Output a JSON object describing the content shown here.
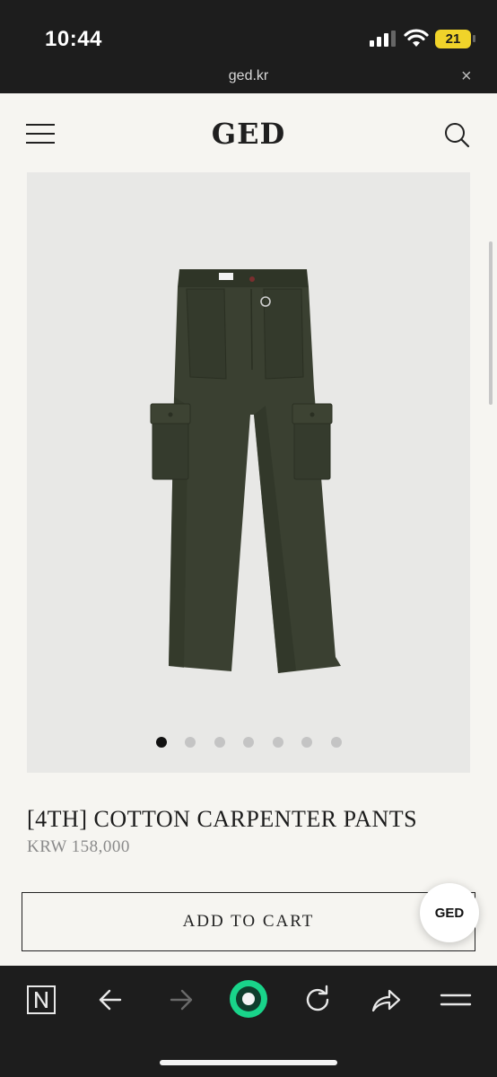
{
  "status_bar": {
    "time": "10:44",
    "battery": "21"
  },
  "url_bar": {
    "domain": "ged.kr",
    "close": "×"
  },
  "site_header": {
    "logo": "GED"
  },
  "gallery": {
    "slide_count": 7,
    "active_index": 0
  },
  "product": {
    "title": "[4TH] COTTON CARPENTER PANTS",
    "price": "KRW 158,000",
    "color_hex": "#3a4031"
  },
  "actions": {
    "add_to_cart": "ADD TO CART",
    "floating_badge": "GED"
  },
  "toolbar": {
    "items": [
      "n-logo-icon",
      "back-arrow-icon",
      "forward-arrow-icon",
      "green-orb-icon",
      "reload-icon",
      "share-icon",
      "menu-icon"
    ],
    "forward_enabled": false,
    "accent_color": "#19d48a"
  }
}
